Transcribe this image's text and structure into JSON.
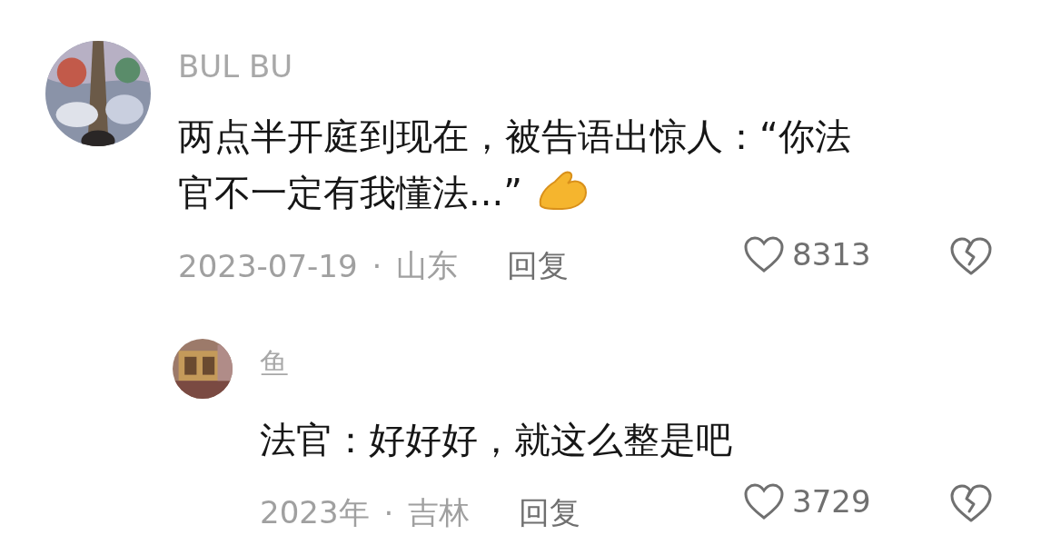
{
  "comments": [
    {
      "kind": "comment",
      "username": "BUL BU",
      "text": "两点半开庭到现在，被告语出惊人：“你法官不一定有我懂法...”",
      "emoji": true,
      "date": "2023-07-19",
      "separator": "·",
      "location": "山东",
      "reply": "回复",
      "likes": "8313"
    },
    {
      "kind": "reply",
      "username": "鱼",
      "text": "法官：好好好，就这么整是吧",
      "emoji": false,
      "date": "2023年",
      "separator": "·",
      "location": "吉林",
      "reply": "回复",
      "likes": "3729"
    }
  ]
}
